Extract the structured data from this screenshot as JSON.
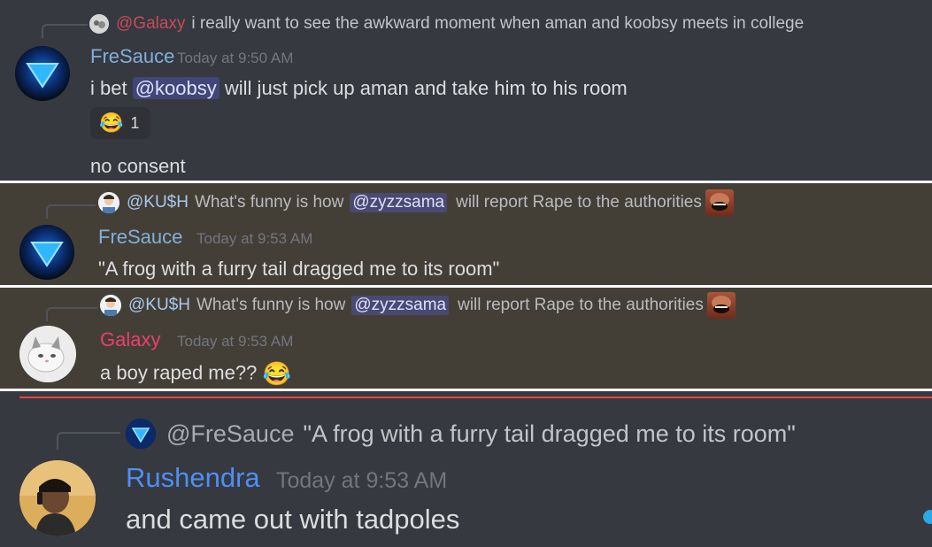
{
  "colors": {
    "panel_dark": "#36393f",
    "panel_highlight": "#433f37",
    "mention_bg": "#4752c4",
    "username_blue": "#4e8ef7",
    "username_red": "#ed4245",
    "new_messages_divider": "#ed4245"
  },
  "panel1": {
    "reply": {
      "author": "@Galaxy",
      "text": "i really want to see the awkward moment when aman and koobsy meets in college"
    },
    "author": "FreSauce",
    "timestamp": "Today at 9:50 AM",
    "message": {
      "prefix": "i bet",
      "mention": "@koobsy",
      "suffix": "will just pick up aman and take him to his room"
    },
    "reaction": {
      "emoji": "😂",
      "count": "1"
    },
    "message2": "no consent"
  },
  "panel2": {
    "reply": {
      "author": "@KU$H",
      "prefix": "What's funny is how",
      "mention": "@zyzzsama",
      "suffix": "will report Rape to the authorities"
    },
    "author": "FreSauce",
    "timestamp": "Today at 9:53 AM",
    "message": "\"A frog with a furry tail dragged me to its room\""
  },
  "panel3": {
    "reply": {
      "author": "@KU$H",
      "prefix": "What's funny is how",
      "mention": "@zyzzsama",
      "suffix": "will report Rape to the authorities"
    },
    "author": "Galaxy",
    "timestamp": "Today at 9:53 AM",
    "message": "a boy raped me??",
    "emoji": "😂"
  },
  "panel4": {
    "reply": {
      "author": "@FreSauce",
      "text": "\"A frog with a furry tail dragged me to its room\""
    },
    "author": "Rushendra",
    "timestamp": "Today at 9:53 AM",
    "message": "and came out with tadpoles"
  }
}
